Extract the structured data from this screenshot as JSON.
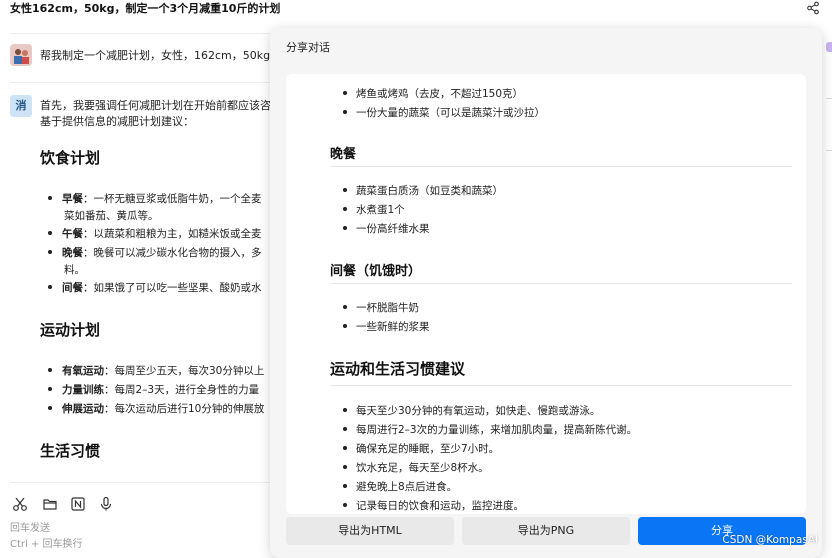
{
  "header": {
    "title": "女性162cm，50kg，制定一个3个月减重10斤的计划"
  },
  "chat": {
    "user_message": "帮我制定一个减肥计划，女性，162cm，50kg，",
    "bot_avatar": "消",
    "bot_intro_1": "首先，我要强调任何减肥计划在开始前都应该咨",
    "bot_intro_2": "基于提供信息的减肥计划建议：",
    "diet_heading": "饮食计划",
    "diet_items": [
      {
        "label": "早餐",
        "text": "：一杯无糖豆浆或低脂牛奶，一个全麦"
      },
      {
        "label": "",
        "text": "菜如番茄、黄瓜等。"
      },
      {
        "label": "午餐",
        "text": "：以蔬菜和粗粮为主，如糙米饭或全麦"
      },
      {
        "label": "晚餐",
        "text": "：晚餐可以减少碳水化合物的摄入，多"
      },
      {
        "label": "",
        "text": "料。"
      },
      {
        "label": "间餐",
        "text": "：如果饿了可以吃一些坚果、酸奶或水"
      }
    ],
    "exercise_heading": "运动计划",
    "exercise_items": [
      {
        "label": "有氧运动",
        "text": "：每周至少五天，每次30分钟以上"
      },
      {
        "label": "力量训练",
        "text": "：每周2–3天，进行全身性的力量"
      },
      {
        "label": "伸展运动",
        "text": "：每次运动后进行10分钟的伸展放"
      }
    ],
    "life_heading": "生活习惯"
  },
  "input_area": {
    "tools": [
      "scissors-icon",
      "folder-icon",
      "notion-icon",
      "microphone-icon"
    ],
    "hint_send": "回车发送",
    "hint_newline": "Ctrl + 回车换行"
  },
  "modal": {
    "title": "分享对话",
    "top_items": [
      "烤鱼或烤鸡（去皮，不超过150克）",
      "一份大量的蔬菜（可以是蔬菜汁或沙拉）"
    ],
    "dinner_heading": "晚餐",
    "dinner_items": [
      "蔬菜蛋白质汤（如豆类和蔬菜）",
      "水煮蛋1个",
      "一份高纤维水果"
    ],
    "snack_heading": "间餐（饥饿时）",
    "snack_items": [
      "一杯脱脂牛奶",
      "一些新鲜的浆果"
    ],
    "habits_heading": "运动和生活习惯建议",
    "habits_items": [
      "每天至少30分钟的有氧运动，如快走、慢跑或游泳。",
      "每周进行2–3次的力量训练，来增加肌肉量，提高新陈代谢。",
      "确保充足的睡眠，至少7小时。",
      "饮水充足，每天至少8杯水。",
      "避免晚上8点后进食。",
      "记录每日的饮食和运动，监控进度。"
    ],
    "buttons": {
      "export_html": "导出为HTML",
      "export_png": "导出为PNG",
      "share": "分享"
    }
  },
  "watermark": "CSDN @KompasAI",
  "colors": {
    "primary": "#0b76f5",
    "modal_bg": "#f5f5f5",
    "button_gray": "#e9e9e9"
  }
}
